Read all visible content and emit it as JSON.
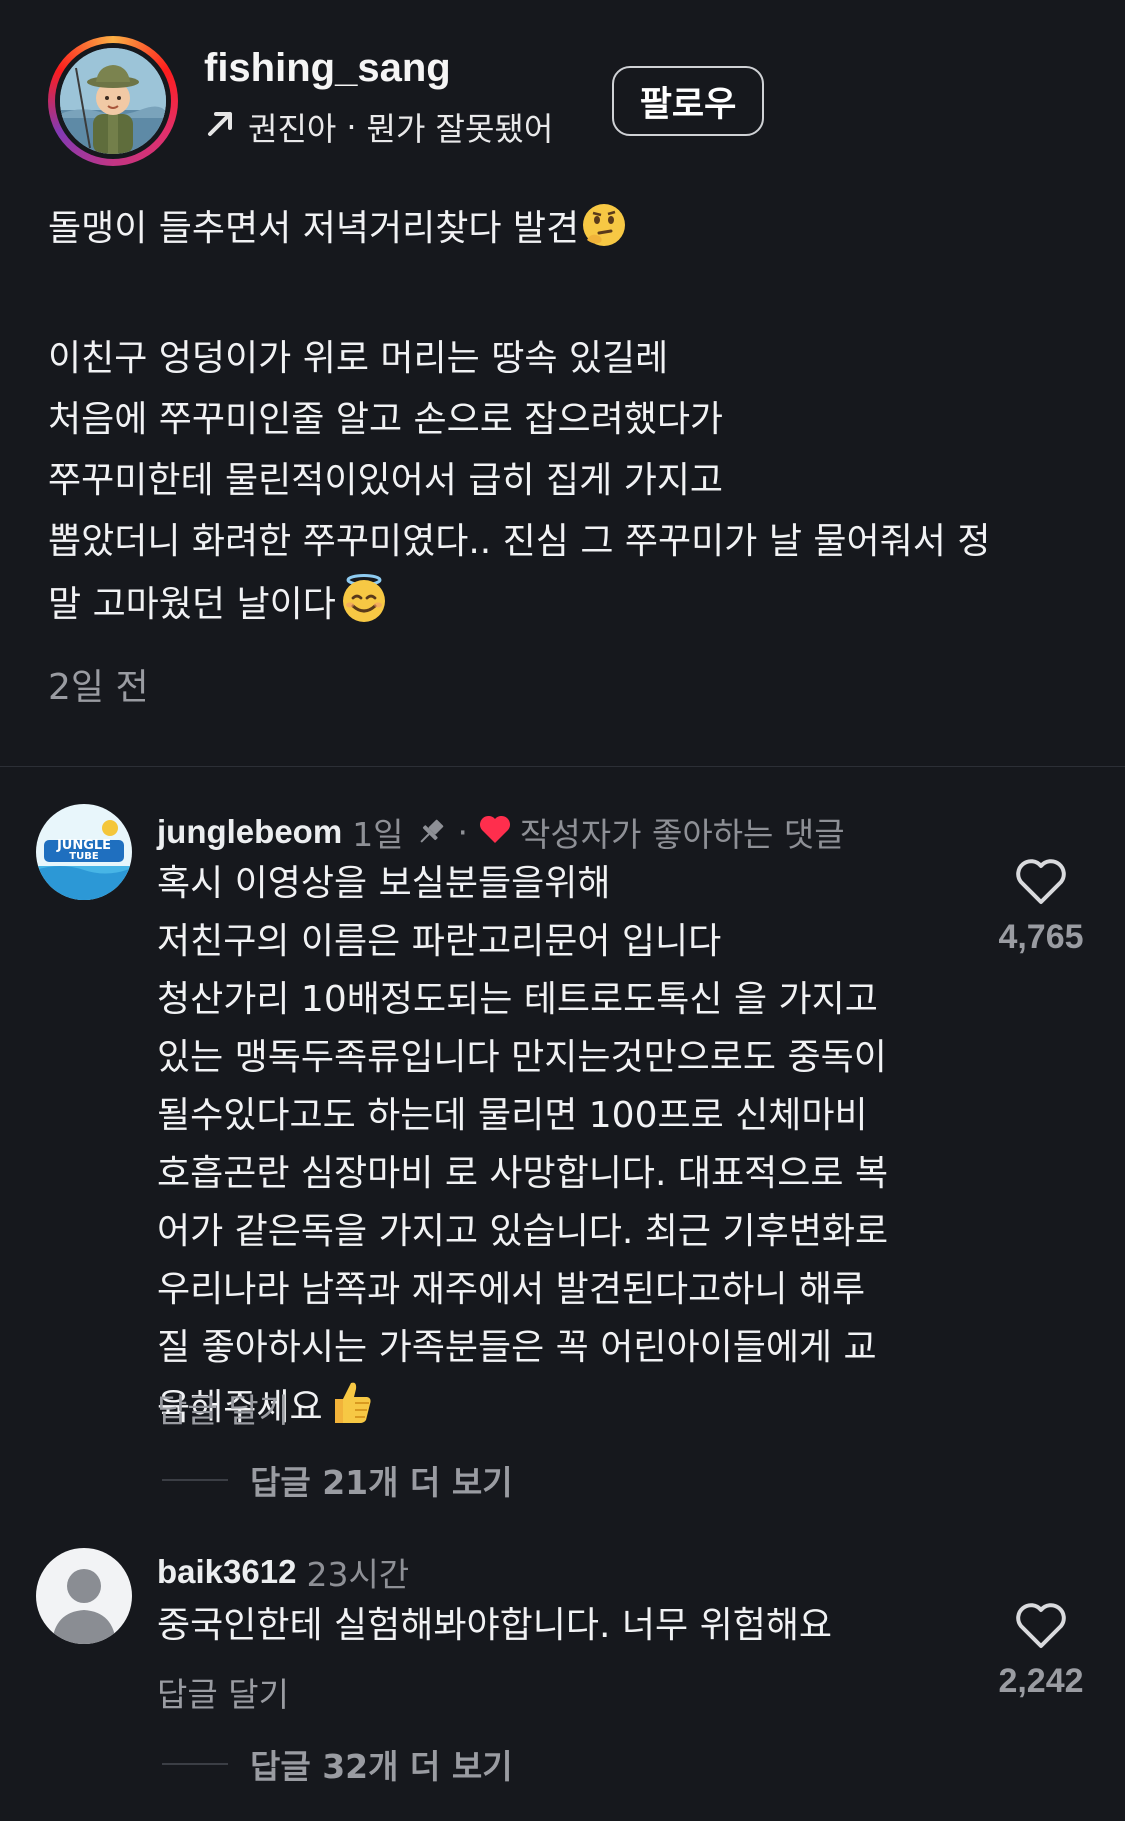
{
  "post": {
    "username": "fishing_sang",
    "audio_user": "권진아",
    "audio_separator": "·",
    "audio_title": "뭔가 잘못됐어",
    "follow_label": "팔로우",
    "caption_line_1": "돌맹이 들추면서 저녁거리찾다 발견",
    "caption_line_2": "이친구 엉덩이가 위로 머리는 땅속 있길레",
    "caption_line_3": "처음에 쭈꾸미인줄 알고 손으로 잡으려했다가",
    "caption_line_4": "쭈꾸미한테 물린적이있어서 급히 집게 가지고",
    "caption_line_5": "뽑았더니 화려한 쭈꾸미였다.. 진심 그 쭈꾸미가 날 물어줘서 정",
    "caption_line_6": "말 고마웠던 날이다",
    "time": "2일 전"
  },
  "comments": [
    {
      "username": "junglebeom",
      "time": "1일",
      "separator": "·",
      "liked_by_author": "작성자가 좋아하는 댓글",
      "avatar_text_1": "JUNGLE",
      "avatar_text_2": "TUBE",
      "lines": [
        "혹시 이영상을 보실분들을위해",
        "저친구의 이름은 파란고리문어 입니다",
        "청산가리 10배정도되는 테트로도톡신 을 가지고",
        "있는 맹독두족류입니다 만지는것만으로도 중독이",
        "될수있다고도 하는데 물리면 100프로 신체마비",
        "호흡곤란 심장마비 로 사망합니다. 대표적으로 복",
        "어가 같은독을 가지고 있습니다. 최근 기후변화로",
        "우리나라 남쪽과 재주에서 발견된다고하니 해루",
        "질 좋아하시는 가족분들은 꼭 어린아이들에게 교",
        "육해주세요"
      ],
      "reply_label": "답글 달기",
      "more_replies": "답글 21개 더 보기",
      "likes": "4,765"
    },
    {
      "username": "baik3612",
      "time": "23시간",
      "lines": [
        "중국인한테 실험해봐야합니다. 너무 위험해요"
      ],
      "reply_label": "답글 달기",
      "more_replies": "답글 32개 더 보기",
      "likes": "2,242"
    }
  ],
  "icons": {
    "audio": "arrow-up-right-icon",
    "thinking": "thinking-face-emoji",
    "halo": "smiling-face-with-halo-emoji",
    "thumbs": "thumbs-up-emoji",
    "pin": "pin-icon",
    "heart_filled": "red-heart-icon",
    "like": "heart-outline-icon"
  },
  "colors": {
    "background": "#16181d",
    "muted": "#9a9ca2",
    "heart": "#ff2e4d"
  }
}
